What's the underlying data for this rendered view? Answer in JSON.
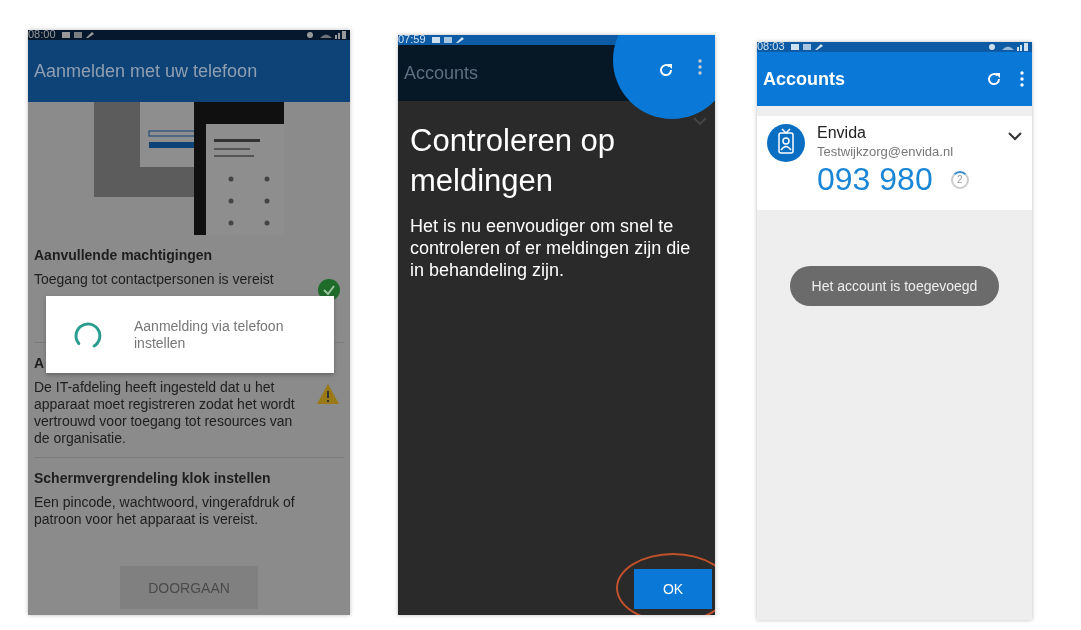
{
  "setup_screen": {
    "status_time": "08:00",
    "title": "Aanmelden met uw telefoon",
    "sections": [
      {
        "heading": "Aanvullende machtigingen",
        "body": "Toegang tot contactpersonen is vereist",
        "kind": "ok"
      },
      {
        "heading": "A",
        "body": "De IT-afdeling heeft ingesteld dat u het apparaat moet registreren zodat het wordt vertrouwd voor toegang tot resources van de organisatie.",
        "kind": "warning"
      },
      {
        "heading": "Schermvergrendeling klok instellen",
        "body": "Een pincode, wachtwoord, vingerafdruk of patroon voor het apparaat is vereist.",
        "kind": "plain"
      }
    ],
    "dialog": {
      "message": "Aanmelding via telefoon instellen"
    },
    "button": {
      "label": "DOORGAAN",
      "disabled": true
    }
  },
  "coachmark_screen": {
    "status_time": "07:59",
    "title": "Accounts",
    "heading": "Controleren op meldingen",
    "body": "Het is nu eenvoudiger om snel te controleren of er meldingen zijn die in behandeling zijn.",
    "button": {
      "label": "OK"
    }
  },
  "accounts_screen": {
    "status_time": "08:03",
    "title": "Accounts",
    "account": {
      "name": "Envida",
      "email": "Testwijkzorg@envida.nl",
      "code": "093 980",
      "seconds": "2"
    },
    "toast": "Het account is toegevoegd"
  }
}
